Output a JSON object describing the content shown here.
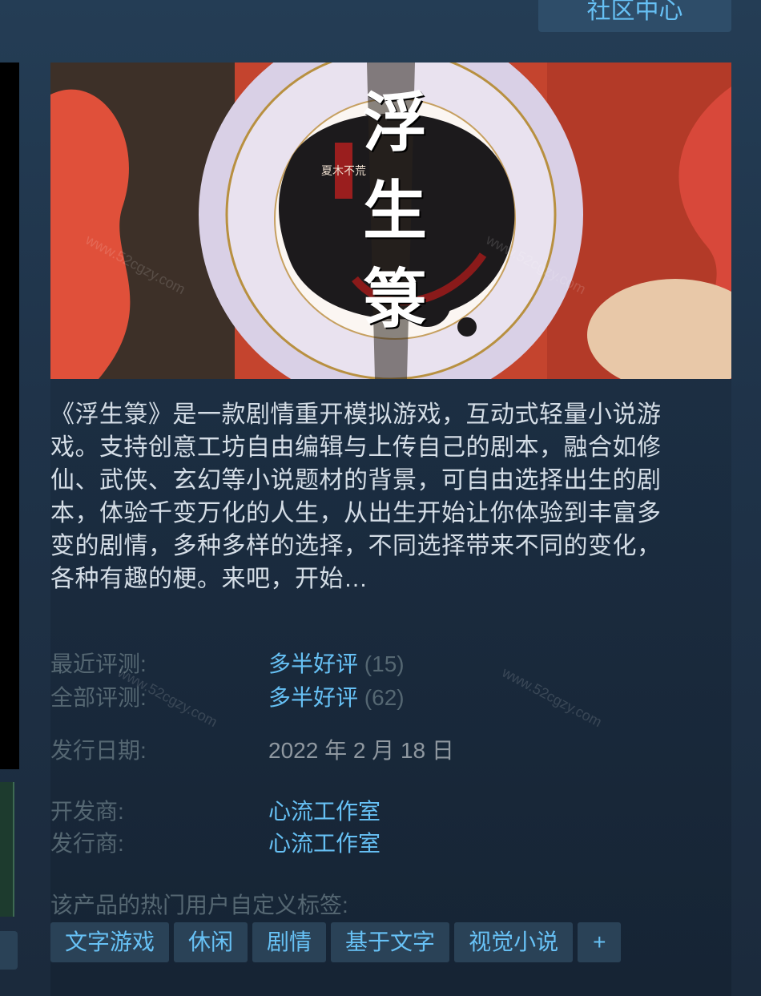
{
  "header": {
    "community_hub_label": "社区中心"
  },
  "game": {
    "logo_text": "浮生箓",
    "logo_seal_text": "夏木不荒",
    "description": "《浮生箓》是一款剧情重开模拟游戏，互动式轻量小说游戏。支持创意工坊自由编辑与上传自己的剧本，融合如修仙、武侠、玄幻等小说题材的背景，可自由选择出生的剧本，体验千变万化的人生，从出生开始让你体验到丰富多变的剧情，多种多样的选择，不同选择带来不同的变化，各种有趣的梗。来吧，开始…"
  },
  "reviews": {
    "recent": {
      "label": "最近评测:",
      "summary": "多半好评",
      "count": "(15)"
    },
    "all": {
      "label": "全部评测:",
      "summary": "多半好评",
      "count": "(62)"
    }
  },
  "release": {
    "label": "发行日期:",
    "date": "2022 年 2 月 18 日"
  },
  "developer": {
    "label": "开发商:",
    "name": "心流工作室"
  },
  "publisher": {
    "label": "发行商:",
    "name": "心流工作室"
  },
  "tags": {
    "label": "该产品的热门用户自定义标签:",
    "items": [
      "文字游戏",
      "休闲",
      "剧情",
      "基于文字",
      "视觉小说"
    ],
    "more": "+"
  },
  "watermark": "www.52cgzy.com",
  "colors": {
    "link": "#66c0f4",
    "tag_bg": "#2a4257",
    "label": "#556772"
  }
}
